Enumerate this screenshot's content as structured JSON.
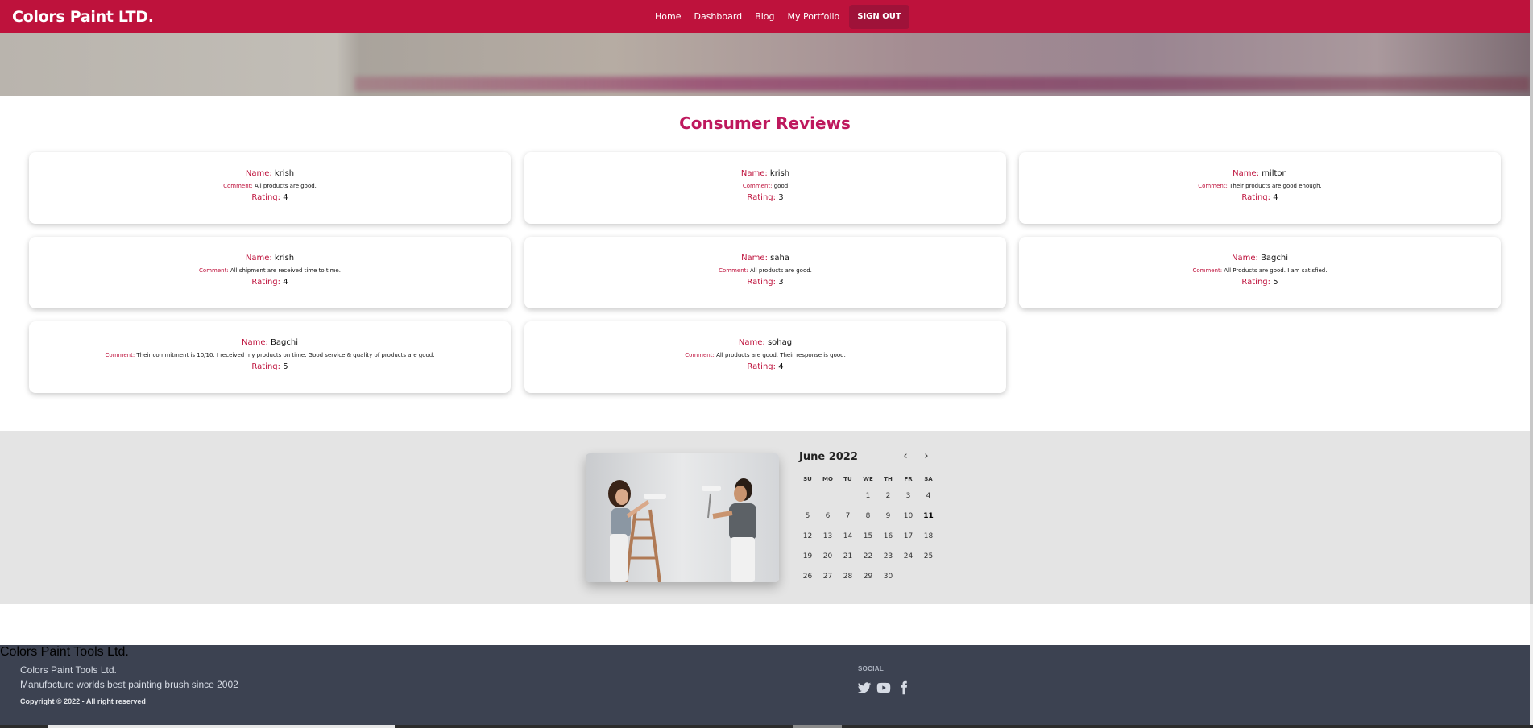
{
  "navbar": {
    "brand": "Colors Paint LTD.",
    "links": [
      "Home",
      "Dashboard",
      "Blog",
      "My Portfolio"
    ],
    "signout": "SIGN OUT",
    "color": "#be123c"
  },
  "reviews": {
    "title": "Consumer Reviews",
    "name_label": "Name:",
    "comment_label": "Comment:",
    "rating_label": "Rating:",
    "items": [
      {
        "name": "krish",
        "comment": "All products are good.",
        "rating": "4"
      },
      {
        "name": "krish",
        "comment": "good",
        "rating": "3"
      },
      {
        "name": "milton",
        "comment": "Their products are good enough.",
        "rating": "4"
      },
      {
        "name": "krish",
        "comment": "All shipment are received time to time.",
        "rating": "4"
      },
      {
        "name": "saha",
        "comment": "All products are good.",
        "rating": "3"
      },
      {
        "name": "Bagchi",
        "comment": "All Products are good. I am satisfied.",
        "rating": "5"
      },
      {
        "name": "Bagchi",
        "comment": "Their commitment is 10/10. I received my products on time. Good service & quality of products are good.",
        "rating": "5"
      },
      {
        "name": "sohag",
        "comment": "All products are good. Their response is good.",
        "rating": "4"
      }
    ]
  },
  "calendar": {
    "month_label": "June 2022",
    "weekdays": [
      "SU",
      "MO",
      "TU",
      "WE",
      "TH",
      "FR",
      "SA"
    ],
    "days": [
      "",
      "",
      "",
      "1",
      "2",
      "3",
      "4",
      "5",
      "6",
      "7",
      "8",
      "9",
      "10",
      "11",
      "12",
      "13",
      "14",
      "15",
      "16",
      "17",
      "18",
      "19",
      "20",
      "21",
      "22",
      "23",
      "24",
      "25",
      "26",
      "27",
      "28",
      "29",
      "30"
    ],
    "today": "11",
    "prev_icon": "chevron-left-icon",
    "next_icon": "chevron-right-icon"
  },
  "footer": {
    "company": "Colors Paint Tools Ltd.",
    "tagline": "Manufacture worlds best painting brush since 2002",
    "copyright": "Copyright © 2022 - All right reserved",
    "social_title": "SOCIAL",
    "social_icons": [
      "twitter-icon",
      "youtube-icon",
      "facebook-icon"
    ]
  }
}
